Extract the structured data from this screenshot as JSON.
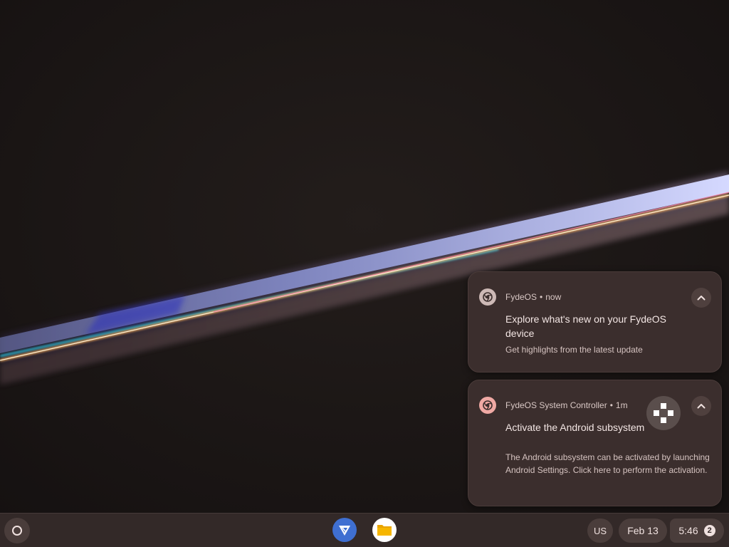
{
  "notifications": [
    {
      "app_name": "FydeOS",
      "separator": "•",
      "time": "now",
      "title": "Explore what's new on your FydeOS device",
      "body": "Get highlights from the latest update",
      "icon": "chrome-icon"
    },
    {
      "app_name": "FydeOS System Controller",
      "separator": "•",
      "time": "1m",
      "title": "Activate the Android subsystem",
      "body": "The Android subsystem can be activated by launching Android Settings. Click here to perform the activation.",
      "icon": "chrome-icon",
      "large_icon": "gamepad-dpad-icon"
    }
  ],
  "shelf": {
    "launcher_icon": "launcher-circle-icon",
    "apps": [
      {
        "name": "FydeOS",
        "icon": "fydeos-app-icon"
      },
      {
        "name": "Files",
        "icon": "files-folder-icon"
      }
    ],
    "ime": "US",
    "date": "Feb 13",
    "time": "5:46",
    "notification_count": "2"
  },
  "colors": {
    "notification_bg": "#3b2e2d",
    "shelf_bg": "#332928",
    "pill_bg": "#4a3d3b",
    "fydeos_blue": "#3f6fd1",
    "files_yellow": "#f6b600"
  }
}
